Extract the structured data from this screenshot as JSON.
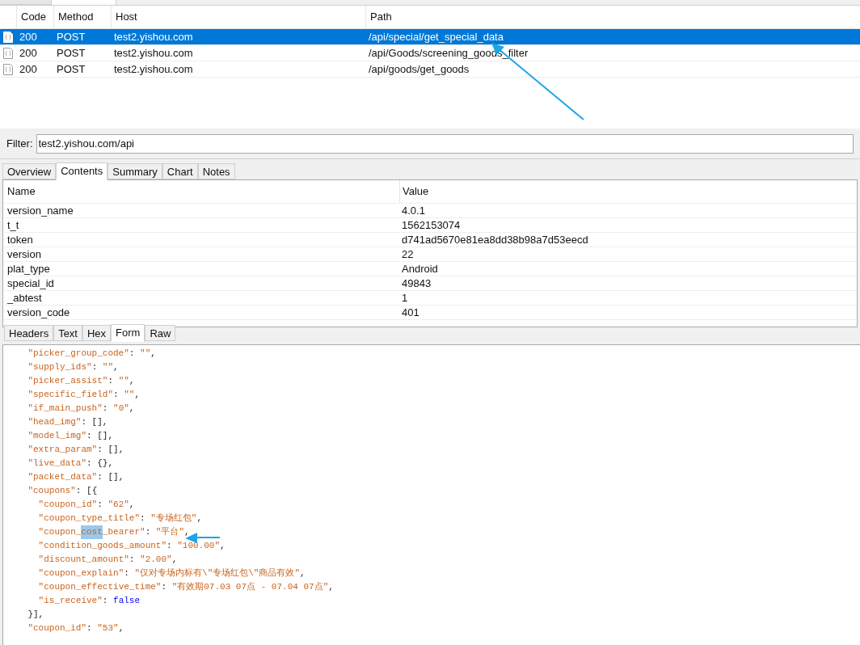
{
  "sessions": {
    "columns": [
      "Code",
      "Method",
      "Host",
      "Path"
    ],
    "rows": [
      {
        "code": "200",
        "method": "POST",
        "host": "test2.yishou.com",
        "path": "/api/special/get_special_data",
        "selected": true
      },
      {
        "code": "200",
        "method": "POST",
        "host": "test2.yishou.com",
        "path": "/api/Goods/screening_goods_filter",
        "selected": false
      },
      {
        "code": "200",
        "method": "POST",
        "host": "test2.yishou.com",
        "path": "/api/goods/get_goods",
        "selected": false
      }
    ]
  },
  "filter": {
    "label": "Filter:",
    "value": "test2.yishou.com/api"
  },
  "detail_tabs": [
    {
      "label": "Overview",
      "selected": false
    },
    {
      "label": "Contents",
      "selected": true
    },
    {
      "label": "Summary",
      "selected": false
    },
    {
      "label": "Chart",
      "selected": false
    },
    {
      "label": "Notes",
      "selected": false
    }
  ],
  "contents": {
    "columns": [
      "Name",
      "Value"
    ],
    "rows": [
      [
        "version_name",
        "4.0.1"
      ],
      [
        "t_t",
        "1562153074"
      ],
      [
        "token",
        "d741ad5670e81ea8dd38b98a7d53eecd"
      ],
      [
        "version",
        "22"
      ],
      [
        "plat_type",
        "Android"
      ],
      [
        "special_id",
        "49843"
      ],
      [
        "_abtest",
        "1"
      ],
      [
        "version_code",
        "401"
      ]
    ]
  },
  "request_tabs": [
    {
      "label": "Headers",
      "selected": false
    },
    {
      "label": "Text",
      "selected": false
    },
    {
      "label": "Hex",
      "selected": false
    },
    {
      "label": "Form",
      "selected": true
    },
    {
      "label": "Raw",
      "selected": false
    }
  ],
  "code": {
    "lines": [
      {
        "text": "    \"picker_group_code\": \"\","
      },
      {
        "text": "    \"supply_ids\": \"\","
      },
      {
        "text": "    \"picker_assist\": \"\","
      },
      {
        "text": "    \"specific_field\": \"\","
      },
      {
        "text": "    \"if_main_push\": \"0\","
      },
      {
        "text": "    \"head_img\": [],"
      },
      {
        "text": "    \"model_img\": [],"
      },
      {
        "text": "    \"extra_param\": [],"
      },
      {
        "text": "    \"live_data\": {},"
      },
      {
        "text": "    \"packet_data\": [],"
      },
      {
        "text": "    \"coupons\": [{"
      },
      {
        "text": "      \"coupon_id\": \"62\","
      },
      {
        "text": "      \"coupon_type_title\": \"专场红包\","
      },
      {
        "before": "      \"coupon_",
        "selection": "cost",
        "after": "_bearer\": \"平台\","
      },
      {
        "text": "      \"condition_goods_amount\": \"100.00\","
      },
      {
        "text": "      \"discount_amount\": \"2.00\","
      },
      {
        "text": "      \"coupon_explain\": \"仅对专场内标有\\\"专场红包\\\"商品有效\","
      },
      {
        "text": "      \"coupon_effective_time\": \"有效期07.03 07点 - 07.04 07点\","
      },
      {
        "text": "      \"is_receive\": false"
      },
      {
        "text": "    }],"
      },
      {
        "text": "    \"coupon_id\": \"53\","
      }
    ]
  }
}
